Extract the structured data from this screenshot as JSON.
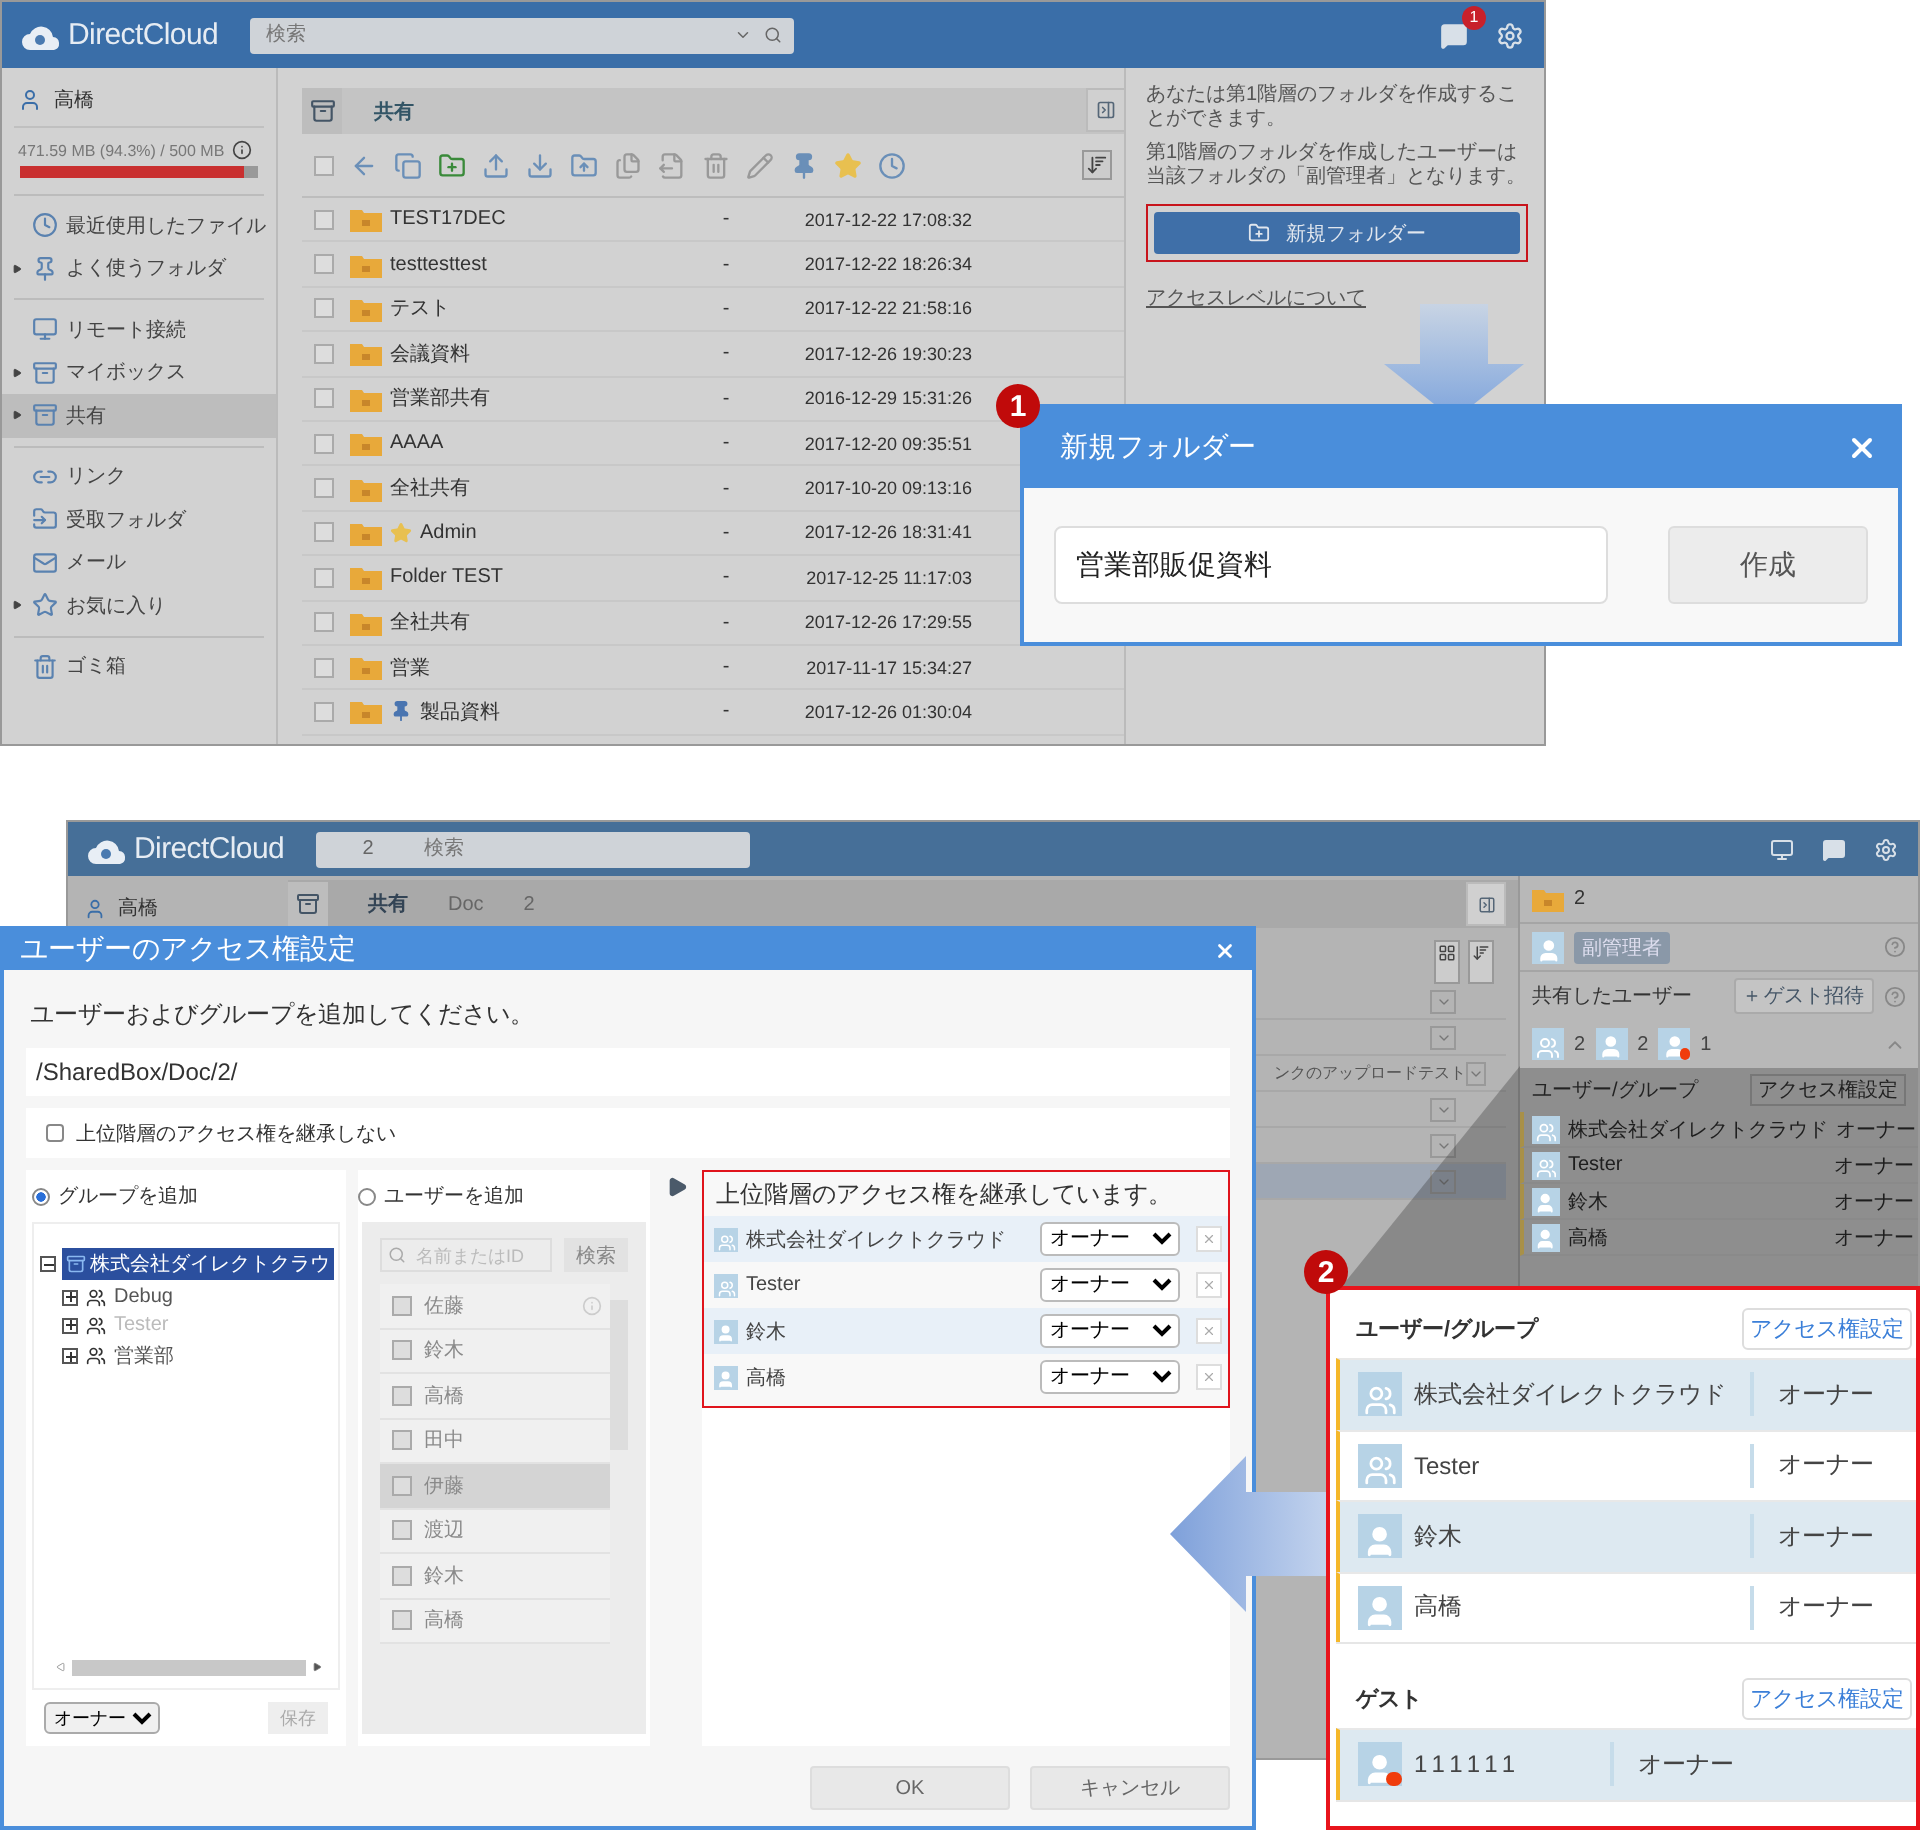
{
  "top_app": {
    "logo": "DirectCloud",
    "search": {
      "placeholder": "検索"
    },
    "notification_count": "1",
    "user": "高橋",
    "storage": {
      "reading": "471.59 MB (94.3%) / 500 MB",
      "level": 0.943
    },
    "nav_groups": [
      [
        {
          "label": "最近使用したファイル",
          "expandable": false,
          "selected": false
        },
        {
          "label": "よく使うフォルダ",
          "expandable": true,
          "selected": false
        }
      ],
      [
        {
          "label": "リモート接続",
          "expandable": false,
          "selected": false
        },
        {
          "label": "マイボックス",
          "expandable": true,
          "selected": false
        },
        {
          "label": "共有",
          "expandable": true,
          "selected": true
        }
      ],
      [
        {
          "label": "リンク",
          "expandable": false,
          "selected": false
        },
        {
          "label": "受取フォルダ",
          "expandable": false,
          "selected": false
        },
        {
          "label": "メール",
          "expandable": false,
          "selected": false
        },
        {
          "label": "お気に入り",
          "expandable": true,
          "selected": false
        }
      ],
      [
        {
          "label": "ゴミ箱",
          "expandable": false,
          "selected": false
        }
      ]
    ],
    "breadcrumb": "共有",
    "select_all": {
      "checked": false
    },
    "files": [
      {
        "name": "TEST17DEC",
        "size": "-",
        "date": "2017-12-22 17:08:32",
        "starred": false,
        "pinned": false
      },
      {
        "name": "testtesttest",
        "size": "-",
        "date": "2017-12-22 18:26:34",
        "starred": false,
        "pinned": false
      },
      {
        "name": "テスト",
        "size": "-",
        "date": "2017-12-22 21:58:16",
        "starred": false,
        "pinned": false
      },
      {
        "name": "会議資料",
        "size": "-",
        "date": "2017-12-26 19:30:23",
        "starred": false,
        "pinned": false
      },
      {
        "name": "営業部共有",
        "size": "-",
        "date": "2016-12-29 15:31:26",
        "starred": false,
        "pinned": false
      },
      {
        "name": "AAAA",
        "size": "-",
        "date": "2017-12-20 09:35:51",
        "starred": false,
        "pinned": false
      },
      {
        "name": "全社共有",
        "size": "-",
        "date": "2017-10-20 09:13:16",
        "starred": false,
        "pinned": false
      },
      {
        "name": "Admin",
        "size": "-",
        "date": "2017-12-26 18:31:41",
        "starred": true,
        "pinned": false
      },
      {
        "name": "Folder TEST",
        "size": "-",
        "date": "2017-12-25 11:17:03",
        "starred": false,
        "pinned": false
      },
      {
        "name": "全社共有",
        "size": "-",
        "date": "2017-12-26 17:29:55",
        "starred": false,
        "pinned": false
      },
      {
        "name": "営業",
        "size": "-",
        "date": "2017-11-17 15:34:27",
        "starred": false,
        "pinned": false
      },
      {
        "name": "製品資料",
        "size": "-",
        "date": "2017-12-26 01:30:04",
        "starred": false,
        "pinned": true
      }
    ],
    "info": [
      "あなたは第1階層のフォルダを作成することができます。",
      "第1階層のフォルダを作成したユーザーは当該フォルダの「副管理者」となります。"
    ],
    "new_folder_button": "新規フォルダー",
    "access_link": "アクセスレベルについて"
  },
  "new_folder_dialog": {
    "step": "1",
    "title": "新規フォルダー",
    "value": "営業部販促資料",
    "button": "作成"
  },
  "bottom_app": {
    "logo": "DirectCloud",
    "search_count": "2",
    "search": {
      "placeholder": "検索"
    },
    "user": "高橋",
    "breadcrumb": [
      "共有",
      "Doc",
      "2"
    ],
    "rows": [
      {
        "selected": false
      },
      {
        "selected": false
      },
      {
        "name": "ンクのアップロードテスト",
        "selected": false
      },
      {
        "selected": false
      },
      {
        "selected": false
      },
      {
        "selected": true
      }
    ],
    "folder": "2",
    "role": "副管理者",
    "shared_heading": "共有したユーザー",
    "guest_invite": "ゲスト招待",
    "counts": [
      {
        "kind": "group",
        "count": "2"
      },
      {
        "kind": "user",
        "count": "2"
      },
      {
        "kind": "guest",
        "count": "1"
      }
    ],
    "list_heading": "ユーザー/グループ",
    "list_button": "アクセス権設定",
    "members": [
      {
        "kind": "group",
        "name": "株式会社ダイレクトクラウド",
        "role": "オーナー"
      },
      {
        "kind": "group",
        "name": "Tester",
        "role": "オーナー"
      },
      {
        "kind": "user",
        "name": "鈴木",
        "role": "オーナー"
      },
      {
        "kind": "user",
        "name": "高橋",
        "role": "オーナー"
      }
    ]
  },
  "access_dialog": {
    "title": "ユーザーのアクセス権設定",
    "instruction": "ユーザーおよびグループを追加してください。",
    "path": "/SharedBox/Doc/2/",
    "no_inherit": {
      "label": "上位階層のアクセス権を継承しない",
      "checked": false
    },
    "modes": [
      {
        "label": "グループを追加",
        "selected": true
      },
      {
        "label": "ユーザーを追加",
        "selected": false
      }
    ],
    "tree": {
      "label": "株式会社ダイレクトクラウ",
      "selected": true,
      "expanded": true,
      "children": [
        {
          "label": "Debug",
          "disabled": false
        },
        {
          "label": "Tester",
          "disabled": true
        },
        {
          "label": "営業部",
          "disabled": false
        }
      ]
    },
    "group_role": "オーナー",
    "save": "保存",
    "user_search": {
      "placeholder": "名前またはID",
      "button": "検索"
    },
    "users": [
      {
        "name": "佐藤",
        "selected": false
      },
      {
        "name": "鈴木",
        "selected": false
      },
      {
        "name": "高橋",
        "selected": false
      },
      {
        "name": "田中",
        "selected": false
      },
      {
        "name": "伊藤",
        "selected": true
      },
      {
        "name": "渡辺",
        "selected": false
      },
      {
        "name": "鈴木",
        "selected": false
      },
      {
        "name": "高橋",
        "selected": false
      }
    ],
    "inherit_note": "上位階層のアクセス権を継承しています。",
    "members": [
      {
        "kind": "group",
        "name": "株式会社ダイレクトクラウド",
        "role": "オーナー"
      },
      {
        "kind": "group",
        "name": "Tester",
        "role": "オーナー"
      },
      {
        "kind": "user",
        "name": "鈴木",
        "role": "オーナー"
      },
      {
        "kind": "user",
        "name": "高橋",
        "role": "オーナー"
      }
    ],
    "ok": "OK",
    "cancel": "キャンセル"
  },
  "callout": {
    "step": "2",
    "sections": [
      {
        "heading": "ユーザー/グループ",
        "button": "アクセス権設定",
        "rows": [
          {
            "kind": "group",
            "name": "株式会社ダイレクトクラウド",
            "role": "オーナー"
          },
          {
            "kind": "group",
            "name": "Tester",
            "role": "オーナー"
          },
          {
            "kind": "user",
            "name": "鈴木",
            "role": "オーナー"
          },
          {
            "kind": "user",
            "name": "高橋",
            "role": "オーナー"
          }
        ]
      },
      {
        "heading": "ゲスト",
        "button": "アクセス権設定",
        "rows": [
          {
            "kind": "guest",
            "name": "111111",
            "role": "オーナー"
          }
        ]
      }
    ]
  }
}
